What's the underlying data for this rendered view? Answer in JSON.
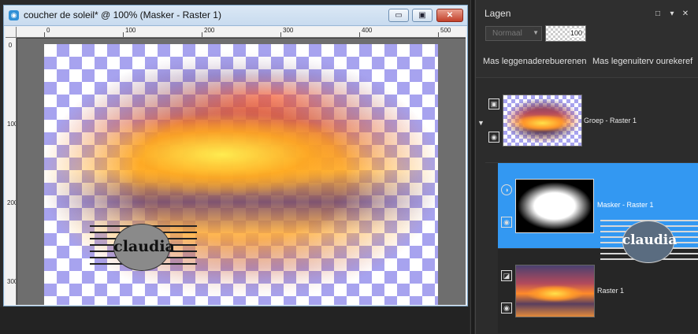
{
  "window": {
    "title": "coucher de soleil* @ 100% (Masker - Raster 1)",
    "buttons": {
      "minimize": "▭",
      "maximize": "▣",
      "close": "✕"
    },
    "ruler_top_labels": [
      "0",
      "100",
      "200",
      "300",
      "400",
      "500"
    ],
    "ruler_left_labels": [
      "0",
      "100",
      "200",
      "300"
    ]
  },
  "watermark": {
    "text": "claudia"
  },
  "panel": {
    "title": "Lagen",
    "buttons": {
      "float": "□",
      "menu": "▾",
      "close": "✕"
    },
    "blend_mode": "Normaal",
    "opacity": "100",
    "toolbar_left": "Mas  leggenaderebuerenen",
    "toolbar_right": "Mas  legenuiterv ourekeref"
  },
  "layers": {
    "group": {
      "name": "Groep - Raster 1"
    },
    "mask": {
      "name": "Masker - Raster 1"
    },
    "raster": {
      "name": "Raster 1"
    }
  },
  "colors": {
    "selection": "#3398f2",
    "checker": "#a7a3ef",
    "titlebar": "#c8dbef"
  }
}
